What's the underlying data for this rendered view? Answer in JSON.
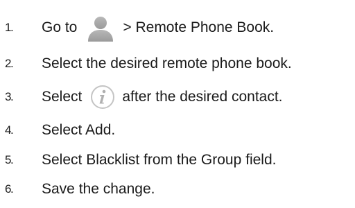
{
  "steps": [
    {
      "number": "1.",
      "before": "Go to",
      "icon": "contacts-person-icon",
      "after": "> Remote Phone Book."
    },
    {
      "number": "2.",
      "text": "Select the desired remote phone book."
    },
    {
      "number": "3.",
      "before": "Select",
      "icon": "info-icon",
      "after": "after the desired contact."
    },
    {
      "number": "4.",
      "text": "Select Add."
    },
    {
      "number": "5.",
      "text": "Select Blacklist from the Group field."
    },
    {
      "number": "6.",
      "text": "Save the change."
    }
  ],
  "colors": {
    "text": "#1a1a1a",
    "icon_gray": "#a6a6a6",
    "info_ring": "#bdbdbd",
    "info_glyph": "#b0b0b0"
  }
}
